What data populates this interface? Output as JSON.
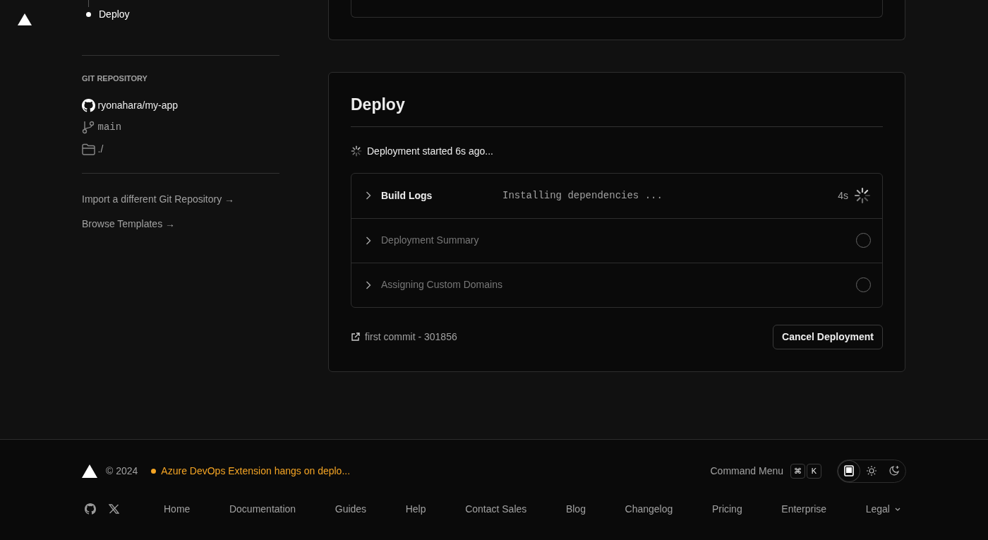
{
  "steps": [
    {
      "label": "Deploy",
      "selected": true
    }
  ],
  "git_repository": {
    "heading": "GIT REPOSITORY",
    "repo": "ryonahara/my-app",
    "branch": "main",
    "directory": "./"
  },
  "sidebar_links": [
    "Import a different Git Repository →",
    "Browse Templates →"
  ],
  "deploy": {
    "title": "Deploy",
    "status": "Deployment started 6s ago...",
    "stages": [
      {
        "label": "Build Logs",
        "kind": "running",
        "detail": "Installing dependencies ...",
        "duration": "4s"
      },
      {
        "label": "Deployment Summary",
        "kind": "pending"
      },
      {
        "label": "Assigning Custom Domains",
        "kind": "pending"
      }
    ],
    "commit": "first commit - 301856",
    "cancel_button": "Cancel Deployment"
  },
  "footer": {
    "copyright": "© 2024",
    "status": {
      "text": "Azure DevOps Extension hangs on deplo...",
      "color": "#f5a524"
    },
    "command_menu": {
      "label": "Command Menu",
      "keys": [
        "⌘",
        "K"
      ]
    },
    "themes": [
      {
        "kind": "system",
        "selected": true
      },
      {
        "kind": "light",
        "selected": false
      },
      {
        "kind": "dark",
        "selected": false
      }
    ],
    "links": [
      "Home",
      "Documentation",
      "Guides",
      "Help",
      "Contact Sales",
      "Blog",
      "Changelog",
      "Pricing",
      "Enterprise",
      "Legal"
    ]
  }
}
